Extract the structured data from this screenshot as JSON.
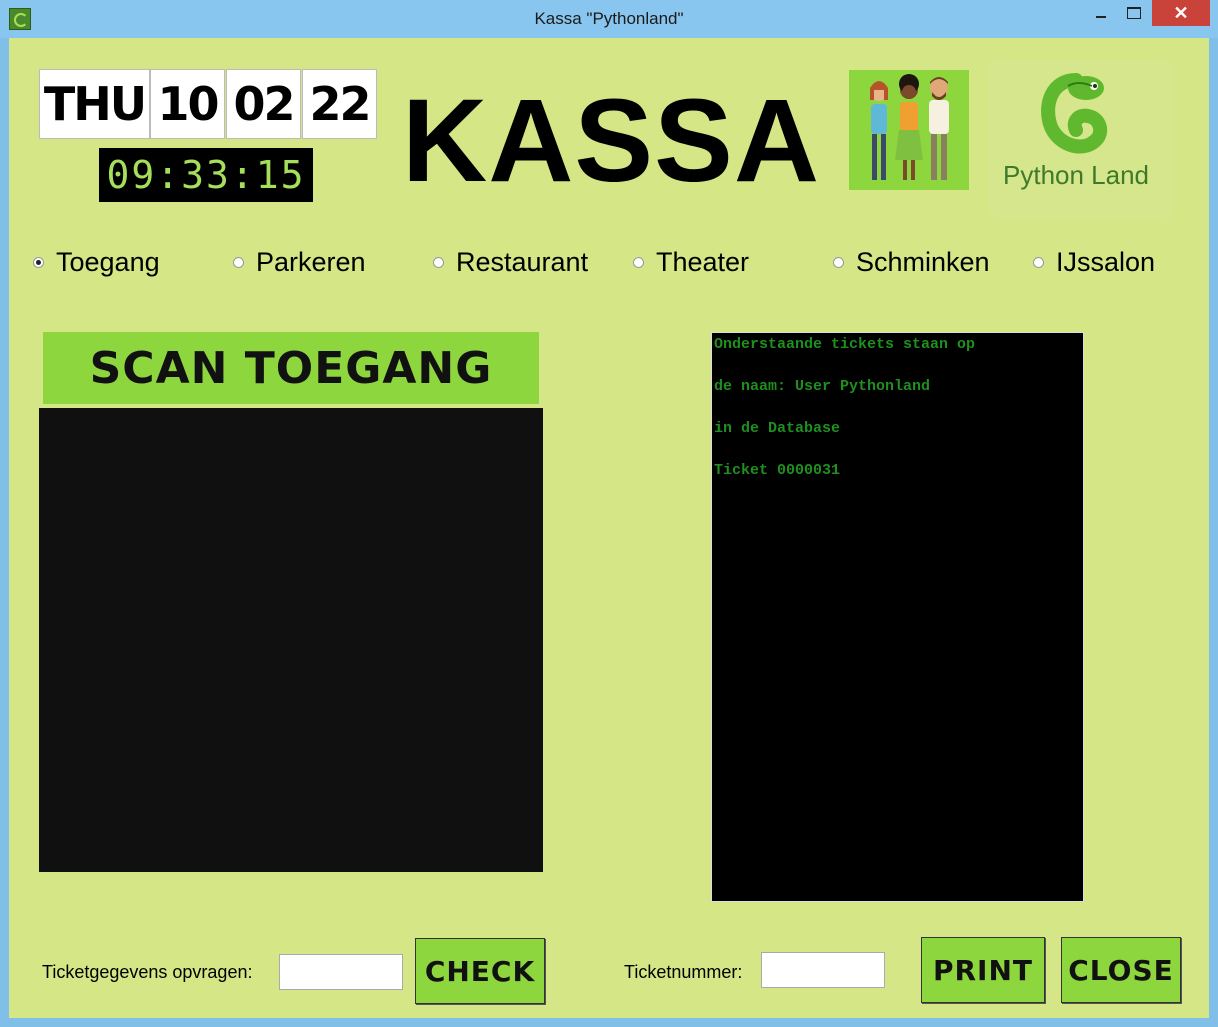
{
  "window": {
    "title": "Kassa \"Pythonland\"",
    "close_glyph": "✕"
  },
  "date": {
    "weekday": "THU",
    "day": "10",
    "month": "02",
    "year": "22"
  },
  "clock": "09:33:15",
  "heading": "KASSA",
  "logo": {
    "text": "Python Land"
  },
  "options": [
    {
      "label": "Toegang",
      "selected": true
    },
    {
      "label": "Parkeren",
      "selected": false
    },
    {
      "label": "Restaurant",
      "selected": false
    },
    {
      "label": "Theater",
      "selected": false
    },
    {
      "label": "Schminken",
      "selected": false
    },
    {
      "label": "IJssalon",
      "selected": false
    }
  ],
  "scan": {
    "title": "SCAN TOEGANG"
  },
  "terminal": {
    "lines": [
      "Onderstaande tickets staan op",
      "de naam: User Pythonland",
      "in de Database",
      "Ticket 0000031"
    ]
  },
  "footer": {
    "lookup_label": "Ticketgegevens opvragen:",
    "lookup_value": "",
    "check_label": "CHECK",
    "ticket_label": "Ticketnummer:",
    "ticket_value": "",
    "print_label": "PRINT",
    "close_label": "CLOSE"
  },
  "colors": {
    "background": "#d4e685",
    "accent_green": "#8ed63e",
    "terminal_text": "#1f8f1f",
    "clock_text": "#a6e05a"
  }
}
